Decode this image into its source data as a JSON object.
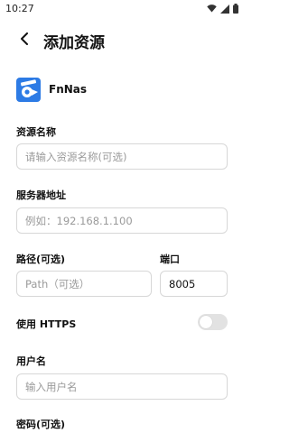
{
  "status_bar": {
    "time": "10:27"
  },
  "header": {
    "title": "添加资源"
  },
  "provider": {
    "name": "FnNas"
  },
  "form": {
    "resource_name": {
      "label": "资源名称",
      "placeholder": "请输入资源名称(可选)"
    },
    "server_address": {
      "label": "服务器地址",
      "placeholder": "例如：192.168.1.100"
    },
    "path": {
      "label": "路径(可选)",
      "placeholder": "Path（可选）"
    },
    "port": {
      "label": "端口",
      "value": "8005"
    },
    "https": {
      "label": "使用 HTTPS",
      "enabled": false
    },
    "username": {
      "label": "用户名",
      "placeholder": "输入用户名"
    },
    "password": {
      "label": "密码(可选)"
    }
  },
  "colors": {
    "accent": "#2d7be5",
    "border": "#d7d7d7",
    "placeholder": "#9a9a9a",
    "toggle_off": "#e2e2e2"
  }
}
